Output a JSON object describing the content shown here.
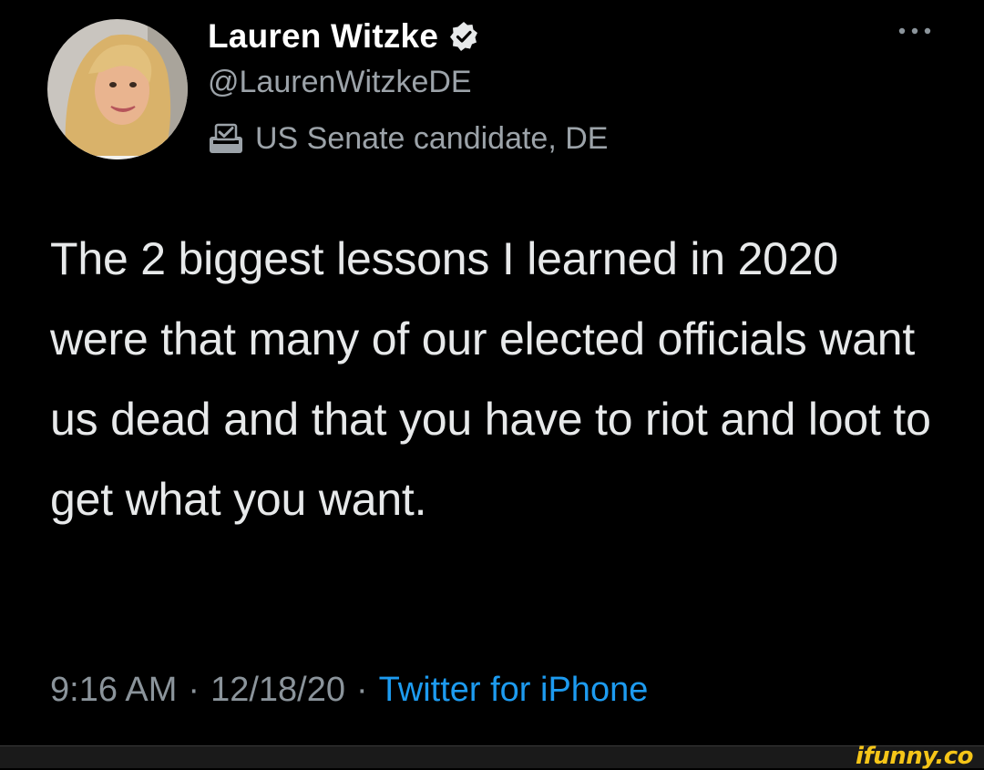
{
  "profile": {
    "display_name": "Lauren Witzke",
    "handle": "@LaurenWitzkeDE",
    "bio": "US Senate candidate, DE",
    "verified": true
  },
  "tweet": {
    "text": "The 2 biggest lessons I learned in 2020 were that many of our elected officials want us dead and that you have to riot and loot to get what you want.",
    "time": "9:16 AM",
    "date": "12/18/20",
    "separator": "·",
    "source": "Twitter for iPhone"
  },
  "icons": {
    "verified": "verified-badge-icon",
    "bio": "ballot-box-icon",
    "more": "more-options-icon"
  },
  "colors": {
    "background": "#000000",
    "accent": "#1d9bf0",
    "secondary_text": "#8b949b"
  },
  "watermark": {
    "text": "ifunny.co"
  }
}
